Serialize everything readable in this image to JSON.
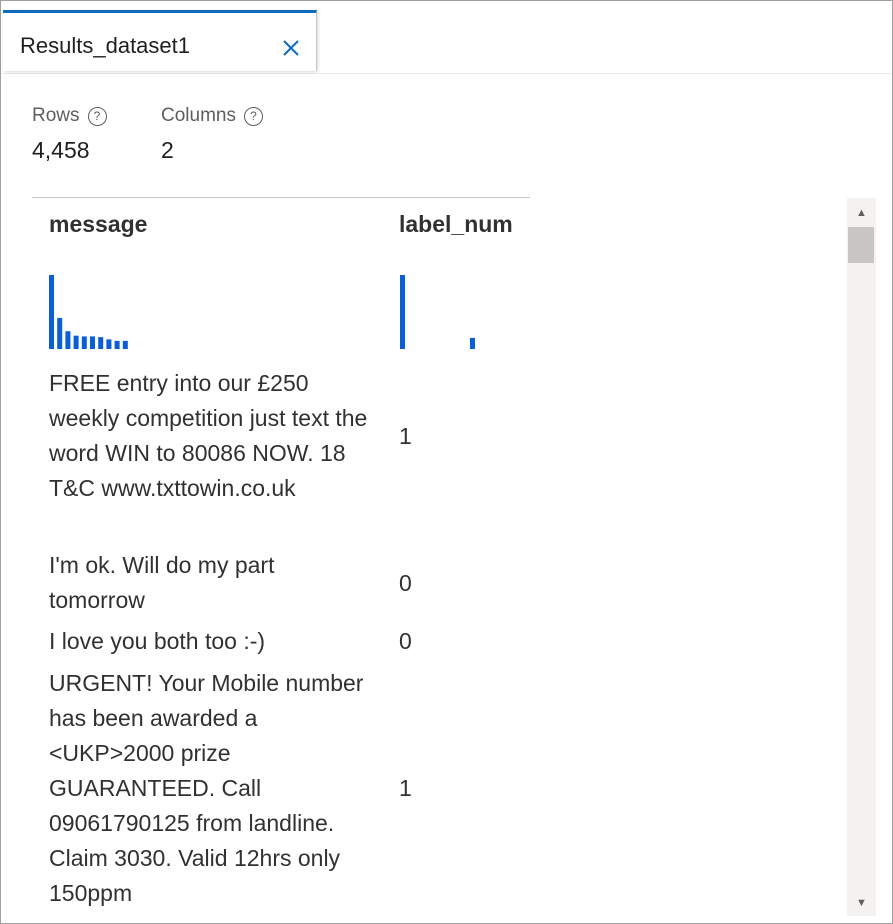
{
  "tab": {
    "label": "Results_dataset1",
    "close_icon": "close-icon"
  },
  "summary": {
    "rows_label": "Rows",
    "rows_value": "4,458",
    "columns_label": "Columns",
    "columns_value": "2",
    "help_icon": "?"
  },
  "table": {
    "columns": [
      "message",
      "label_num"
    ],
    "histograms": {
      "message": [
        1.0,
        0.42,
        0.24,
        0.18,
        0.17,
        0.17,
        0.16,
        0.13,
        0.11,
        0.11
      ],
      "label_num": [
        1.0,
        0.15
      ]
    },
    "rows": [
      {
        "message": "FREE entry into our £250 weekly competition just text the word WIN to 80086 NOW. 18 T&C www.txttowin.co.uk",
        "label_num": "1"
      },
      {
        "message": "I'm ok. Will do my part tomorrow",
        "label_num": "0"
      },
      {
        "message": "I love you both too :-)",
        "label_num": "0"
      },
      {
        "message": "URGENT! Your Mobile number has been awarded a <UKP>2000 prize GUARANTEED. Call 09061790125 from landline. Claim 3030. Valid 12hrs only 150ppm",
        "label_num": "1"
      }
    ]
  },
  "colors": {
    "accent": "#0f6cbd",
    "histogram": "#0a5fd6"
  }
}
